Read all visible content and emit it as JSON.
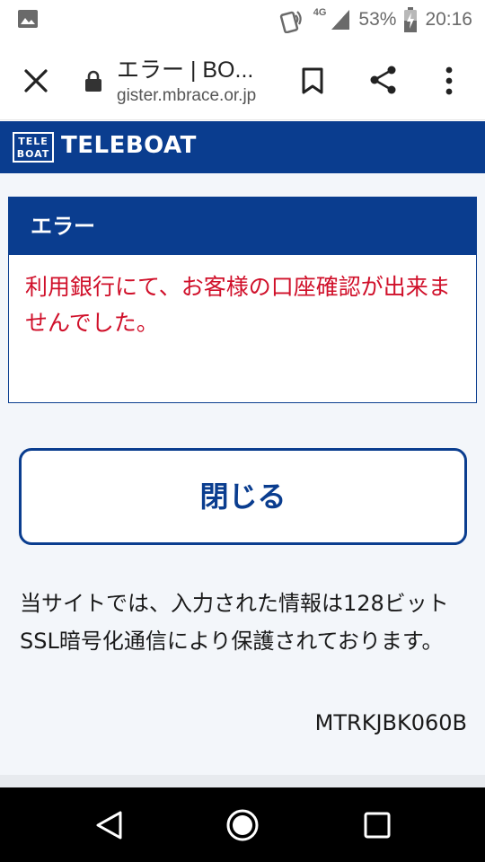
{
  "status_bar": {
    "network": "4G",
    "battery": "53%",
    "time": "20:16"
  },
  "browser": {
    "page_title": "エラー | BO...",
    "url": "gister.mbrace.or.jp",
    "icons": [
      "close-icon",
      "lock-icon",
      "bookmark-icon",
      "share-icon",
      "more-vert-icon"
    ]
  },
  "brand": {
    "logo_line1": "TELE",
    "logo_line2": "BOAT",
    "name": "TELEBOAT"
  },
  "error": {
    "heading": "エラー",
    "message": "利用銀行にて、お客様の口座確認が出来ませんでした。"
  },
  "actions": {
    "close_label": "閉じる"
  },
  "footer": {
    "ssl_note": "当サイトでは、入力された情報は128ビットSSL暗号化通信により保護されております。",
    "page_code": "MTRKJBK060B"
  },
  "colors": {
    "brand": "#0a3d8f",
    "error_text": "#d0102a"
  }
}
